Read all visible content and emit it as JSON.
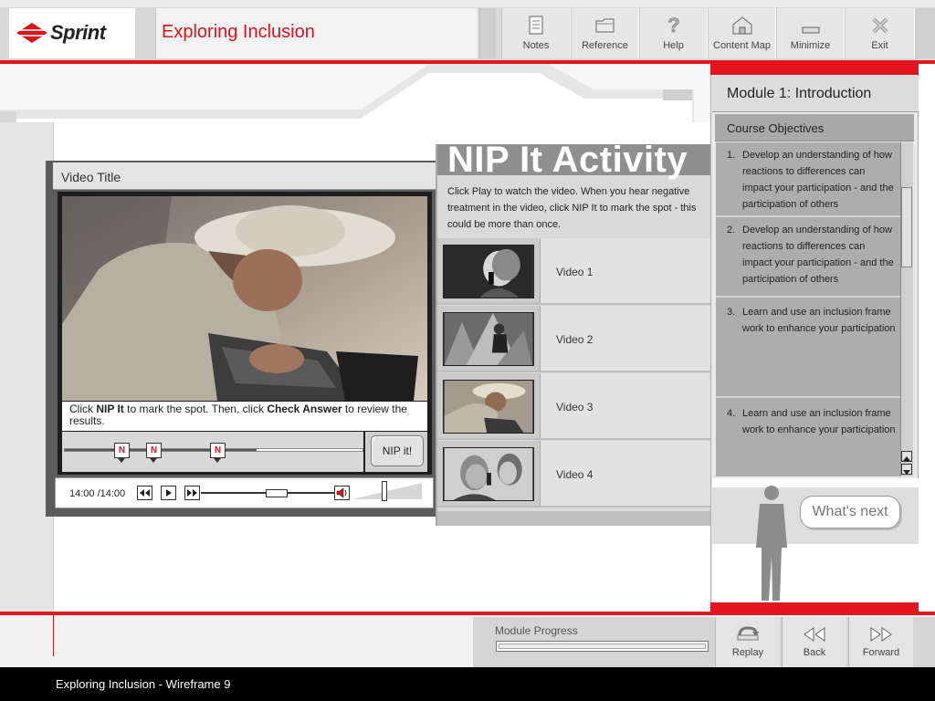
{
  "header": {
    "logo_text": "Sprint",
    "course_title": "Exploring Inclusion",
    "toolbar": [
      {
        "label": "Notes",
        "icon": "notes-icon"
      },
      {
        "label": "Reference",
        "icon": "folder-icon"
      },
      {
        "label": "Help",
        "icon": "question-icon"
      },
      {
        "label": "Content Map",
        "icon": "map-icon"
      },
      {
        "label": "Minimize",
        "icon": "minimize-icon"
      },
      {
        "label": "Exit",
        "icon": "close-icon"
      }
    ]
  },
  "video_panel": {
    "title": "Video Title",
    "instruction_parts": [
      "Click ",
      "NIP It",
      " to mark the spot. Then, click ",
      "Check Answer",
      " to review the results."
    ],
    "markers": [
      "N",
      "N",
      "N"
    ],
    "nip_button": "NIP it!",
    "time": "14:00 /14:00"
  },
  "activity": {
    "title": "NIP It Activity",
    "instructions": "Click Play to watch the video. When you hear negative treatment in the video, click NIP It to mark the spot - this could be more than once.",
    "videos": [
      "Video 1",
      "Video 2",
      "Video 3",
      "Video 4"
    ]
  },
  "sidebar": {
    "module_title": "Module 1: Introduction",
    "objectives_title": "Course Objectives",
    "objectives": [
      {
        "num": "1.",
        "text": "Develop an understanding of how reactions to differences can impact your participation - and the participation of others"
      },
      {
        "num": "2.",
        "text": "Develop an understanding of how reactions to differences can impact your participation - and the participation of others"
      },
      {
        "num": "3.",
        "text": "Learn and use an inclusion frame work to enhance your participation"
      },
      {
        "num": "4.",
        "text": "Learn and use an inclusion frame work to enhance your participation"
      }
    ],
    "whats_next": "What's next"
  },
  "footer": {
    "progress_label": "Module Progress",
    "nav": [
      {
        "label": "Replay",
        "icon": "replay-icon"
      },
      {
        "label": "Back",
        "icon": "back-icon"
      },
      {
        "label": "Forward",
        "icon": "forward-icon"
      }
    ],
    "status_text": "Exploring Inclusion - Wireframe 9"
  },
  "colors": {
    "accent_red": "#e4151f",
    "title_red": "#d9141b",
    "panel_gray": "#d9d9d9"
  }
}
